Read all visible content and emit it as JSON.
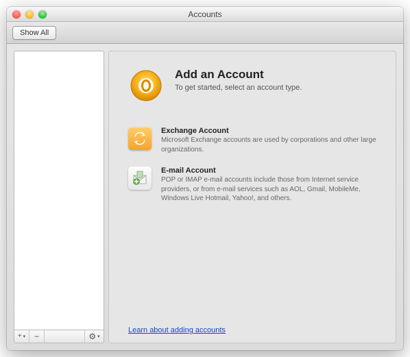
{
  "window": {
    "title": "Accounts",
    "showAll": "Show All"
  },
  "sidebarFooter": {
    "add": "+",
    "remove": "−",
    "gear": "⚙"
  },
  "main": {
    "heading": "Add an Account",
    "subheading": "To get started, select an account type."
  },
  "options": [
    {
      "label": "Exchange Account",
      "desc": "Microsoft Exchange accounts are used by corporations and other large organizations."
    },
    {
      "label": "E-mail Account",
      "desc": "POP or IMAP e-mail accounts include those from Internet service providers, or from e-mail services such as AOL, Gmail, MobileMe, Windows Live Hotmail, Yahoo!, and others."
    }
  ],
  "link": "Learn about adding accounts"
}
